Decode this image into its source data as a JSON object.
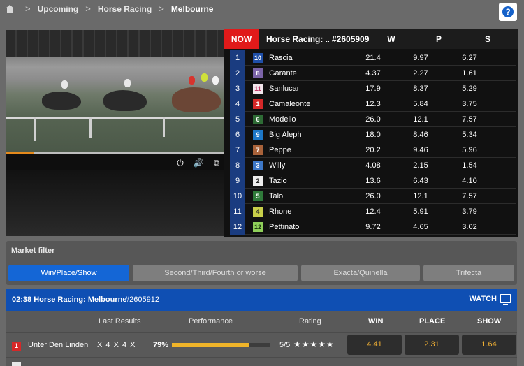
{
  "breadcrumb": {
    "items": [
      "Upcoming",
      "Horse Racing",
      "Melbourne"
    ],
    "separator": ">"
  },
  "help": {
    "label": "?"
  },
  "video": {
    "progress": 0.13,
    "controls": [
      "power-icon",
      "volume-icon",
      "external-link-icon"
    ],
    "accent_color": "#e58a1c"
  },
  "odds_table": {
    "now_label": "NOW",
    "title": "Horse Racing: ...",
    "race_id": "#2605909",
    "columns": [
      "W",
      "P",
      "S"
    ],
    "rows": [
      {
        "pos": "1",
        "saddle": "10",
        "saddle_bg": "#1f4fa8",
        "saddle_fg": "#ffffff",
        "name": "Rascia",
        "w": "21.4",
        "p": "9.97",
        "s": "6.27"
      },
      {
        "pos": "2",
        "saddle": "8",
        "saddle_bg": "#7b63a8",
        "saddle_fg": "#ffffff",
        "name": "Garante",
        "w": "4.37",
        "p": "2.27",
        "s": "1.61"
      },
      {
        "pos": "3",
        "saddle": "11",
        "saddle_bg": "#f2e6ec",
        "saddle_fg": "#c23b6a",
        "name": "Sanlucar",
        "w": "17.9",
        "p": "8.37",
        "s": "5.29"
      },
      {
        "pos": "4",
        "saddle": "1",
        "saddle_bg": "#d62828",
        "saddle_fg": "#ffffff",
        "name": "Camaleonte",
        "w": "12.3",
        "p": "5.84",
        "s": "3.75"
      },
      {
        "pos": "5",
        "saddle": "6",
        "saddle_bg": "#2e6b35",
        "saddle_fg": "#ffffff",
        "name": "Modello",
        "w": "26.0",
        "p": "12.1",
        "s": "7.57"
      },
      {
        "pos": "6",
        "saddle": "9",
        "saddle_bg": "#1d78c8",
        "saddle_fg": "#ffffff",
        "name": "Big Aleph",
        "w": "18.0",
        "p": "8.46",
        "s": "5.34"
      },
      {
        "pos": "7",
        "saddle": "7",
        "saddle_bg": "#a8623a",
        "saddle_fg": "#ffffff",
        "name": "Peppe",
        "w": "20.2",
        "p": "9.46",
        "s": "5.96"
      },
      {
        "pos": "8",
        "saddle": "3",
        "saddle_bg": "#3d78c8",
        "saddle_fg": "#ffffff",
        "name": "Willy",
        "w": "4.08",
        "p": "2.15",
        "s": "1.54"
      },
      {
        "pos": "9",
        "saddle": "2",
        "saddle_bg": "#eeeeee",
        "saddle_fg": "#222222",
        "name": "Tazio",
        "w": "13.6",
        "p": "6.43",
        "s": "4.10"
      },
      {
        "pos": "10",
        "saddle": "5",
        "saddle_bg": "#2f7a3a",
        "saddle_fg": "#ffffff",
        "name": "Talo",
        "w": "26.0",
        "p": "12.1",
        "s": "7.57"
      },
      {
        "pos": "11",
        "saddle": "4",
        "saddle_bg": "#c8cf4a",
        "saddle_fg": "#222222",
        "name": "Rhone",
        "w": "12.4",
        "p": "5.91",
        "s": "3.79"
      },
      {
        "pos": "12",
        "saddle": "12",
        "saddle_bg": "#8fcf5a",
        "saddle_fg": "#1f3a10",
        "name": "Pettinato",
        "w": "9.72",
        "p": "4.65",
        "s": "3.02"
      }
    ]
  },
  "market_filter": {
    "label": "Market filter",
    "tabs": [
      "Win/Place/Show",
      "Second/Third/Fourth or worse",
      "Exacta/Quinella",
      "Trifecta"
    ],
    "active_tab": 0,
    "active_color": "#1466d6"
  },
  "race_card": {
    "title": "02:38 Horse Racing: Melbourne",
    "race_id": "#2605912",
    "watch_label": "WATCH",
    "columns": {
      "last_results": "Last Results",
      "performance": "Performance",
      "rating": "Rating",
      "win": "WIN",
      "place": "PLACE",
      "show": "SHOW"
    },
    "runner": {
      "number": "1",
      "name": "Unter Den Linden",
      "last_results": "X 4 X 4 X",
      "performance_text": "79%",
      "performance": 0.79,
      "rating": "5/5",
      "stars": "★★★★★",
      "win": "4.41",
      "place": "2.31",
      "show": "1.64"
    },
    "header_color": "#0f4fb3"
  }
}
